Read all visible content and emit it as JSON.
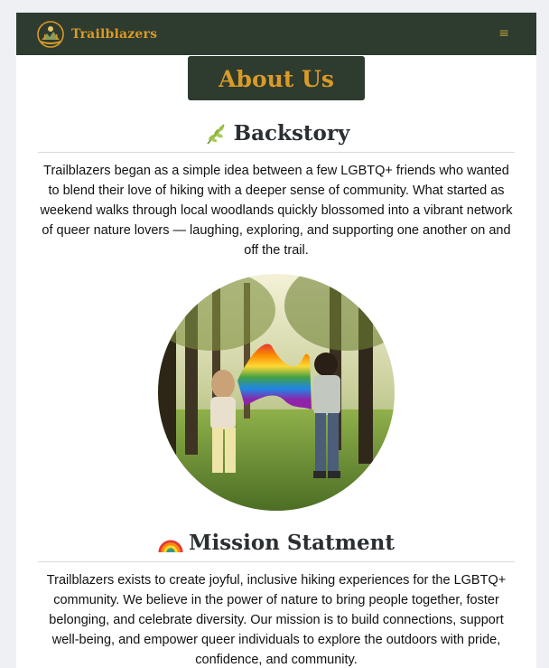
{
  "nav": {
    "brand": "Trailblazers",
    "menu_icon": "≡"
  },
  "page": {
    "heading": "About Us"
  },
  "backstory": {
    "title": "Backstory",
    "emoji": "leaf-icon",
    "text": "Trailblazers began as a simple idea between a few LGBTQ+ friends who wanted to blend their love of hiking with a deeper sense of community. What started as weekend walks through local woodlands quickly blossomed into a vibrant network of queer nature lovers — laughing, exploring, and supporting one another on and off the trail."
  },
  "mission": {
    "title": "Mission Statment",
    "emoji": "rainbow-icon",
    "text": "Trailblazers exists to create joyful, inclusive hiking experiences for the LGBTQ+ community. We believe in the power of nature to bring people together, foster belonging, and celebrate diversity. Our mission is to build connections, support well-being, and empower queer individuals to explore the outdoors with pride, confidence, and community."
  },
  "colors": {
    "nav_bg": "#2e3b2f",
    "accent": "#d99a26",
    "page_bg": "#ffffff"
  }
}
